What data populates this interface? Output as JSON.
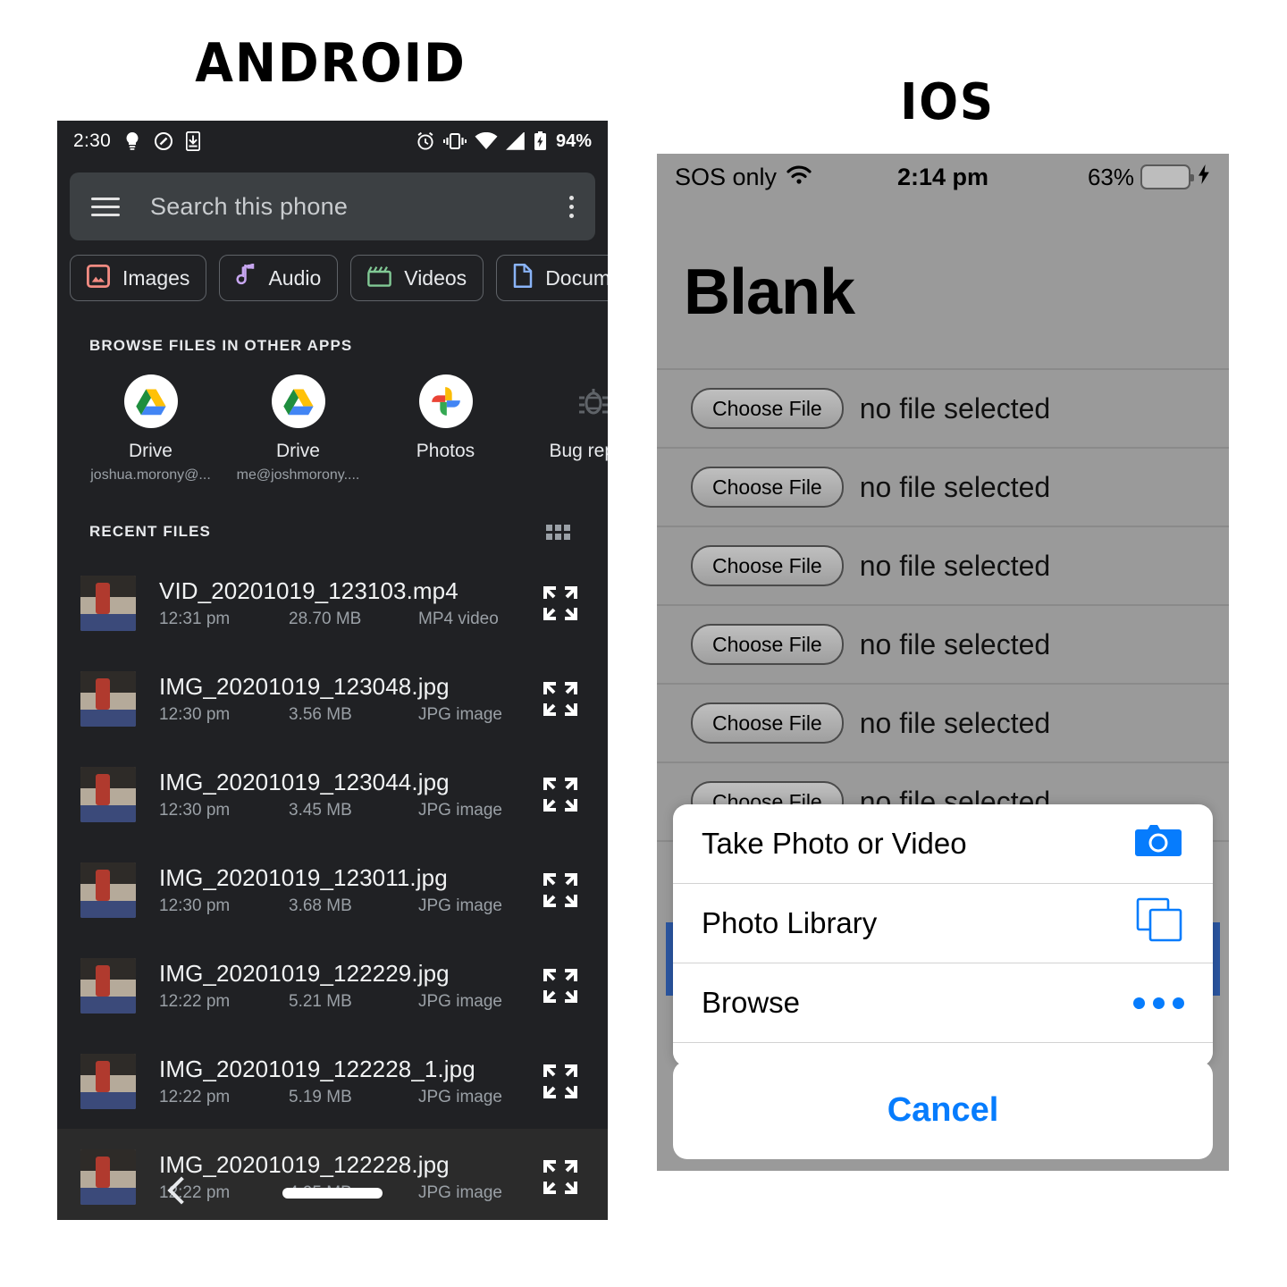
{
  "headings": {
    "android": "ANDROID",
    "ios": "IOS"
  },
  "android": {
    "status_bar": {
      "time": "2:30",
      "left_icons": [
        "lightbulb-icon",
        "do-not-disturb-icon",
        "download-to-phone-icon"
      ],
      "right_icons": [
        "alarm-icon",
        "vibrate-icon",
        "wifi-icon",
        "cell-signal-icon",
        "battery-charging-icon"
      ],
      "battery": "94%"
    },
    "search": {
      "placeholder": "Search this phone",
      "menu_icon": "hamburger-icon",
      "overflow_icon": "kebab-menu-icon"
    },
    "chips": [
      {
        "label": "Images",
        "icon": "image-icon",
        "color": "#f28b82"
      },
      {
        "label": "Audio",
        "icon": "music-note-icon",
        "color": "#c7a6f0"
      },
      {
        "label": "Videos",
        "icon": "clapperboard-icon",
        "color": "#81c995"
      },
      {
        "label": "Docume",
        "icon": "document-icon",
        "color": "#8ab4f8"
      }
    ],
    "browse_section_label": "BROWSE FILES IN OTHER APPS",
    "apps": [
      {
        "name": "Drive",
        "account": "joshua.morony@...",
        "icon": "google-drive-icon"
      },
      {
        "name": "Drive",
        "account": "me@joshmorony....",
        "icon": "google-drive-icon"
      },
      {
        "name": "Photos",
        "account": "",
        "icon": "google-photos-icon"
      },
      {
        "name": "Bug report",
        "account": "",
        "icon": "bug-icon"
      }
    ],
    "recent_section_label": "RECENT FILES",
    "recent_view_toggle_icon": "grid-view-icon",
    "files": [
      {
        "name": "VID_20201019_123103.mp4",
        "time": "12:31 pm",
        "size": "28.70 MB",
        "type": "MP4 video"
      },
      {
        "name": "IMG_20201019_123048.jpg",
        "time": "12:30 pm",
        "size": "3.56 MB",
        "type": "JPG image"
      },
      {
        "name": "IMG_20201019_123044.jpg",
        "time": "12:30 pm",
        "size": "3.45 MB",
        "type": "JPG image"
      },
      {
        "name": "IMG_20201019_123011.jpg",
        "time": "12:30 pm",
        "size": "3.68 MB",
        "type": "JPG image"
      },
      {
        "name": "IMG_20201019_122229.jpg",
        "time": "12:22 pm",
        "size": "5.21 MB",
        "type": "JPG image"
      },
      {
        "name": "IMG_20201019_122228_1.jpg",
        "time": "12:22 pm",
        "size": "5.19 MB",
        "type": "JPG image"
      },
      {
        "name": "IMG_20201019_122228.jpg",
        "time": "12:22 pm",
        "size": "4.95 MB",
        "type": "JPG image"
      }
    ],
    "nav": {
      "back_icon": "back-chevron-icon",
      "home_pill_icon": "home-pill-icon"
    },
    "colors": {
      "background": "#202124",
      "search_field": "#3c4043",
      "text_primary": "#f1f3f4",
      "text_secondary": "#9aa0a6"
    }
  },
  "ios": {
    "status_bar": {
      "carrier": "SOS only",
      "wifi_icon": "wifi-icon",
      "time": "2:14 pm",
      "battery": "63%",
      "battery_icon": "battery-icon",
      "charging_icon": "lightning-bolt-icon"
    },
    "page_title": "Blank",
    "file_inputs": [
      {
        "button": "Choose File",
        "status": "no file selected"
      },
      {
        "button": "Choose File",
        "status": "no file selected"
      },
      {
        "button": "Choose File",
        "status": "no file selected"
      },
      {
        "button": "Choose File",
        "status": "no file selected"
      },
      {
        "button": "Choose File",
        "status": "no file selected"
      },
      {
        "button": "Choose File",
        "status": "no file selected"
      }
    ],
    "action_sheet": {
      "items": [
        {
          "label": "Take Photo or Video",
          "icon": "camera-icon"
        },
        {
          "label": "Photo Library",
          "icon": "photo-stack-icon"
        },
        {
          "label": "Browse",
          "icon": "ellipsis-icon"
        }
      ],
      "cancel_label": "Cancel"
    },
    "colors": {
      "background": "#9a9a9a",
      "accent": "#067cfd",
      "sheet": "#ffffff",
      "highlight_bar": "#2a55a0"
    }
  }
}
